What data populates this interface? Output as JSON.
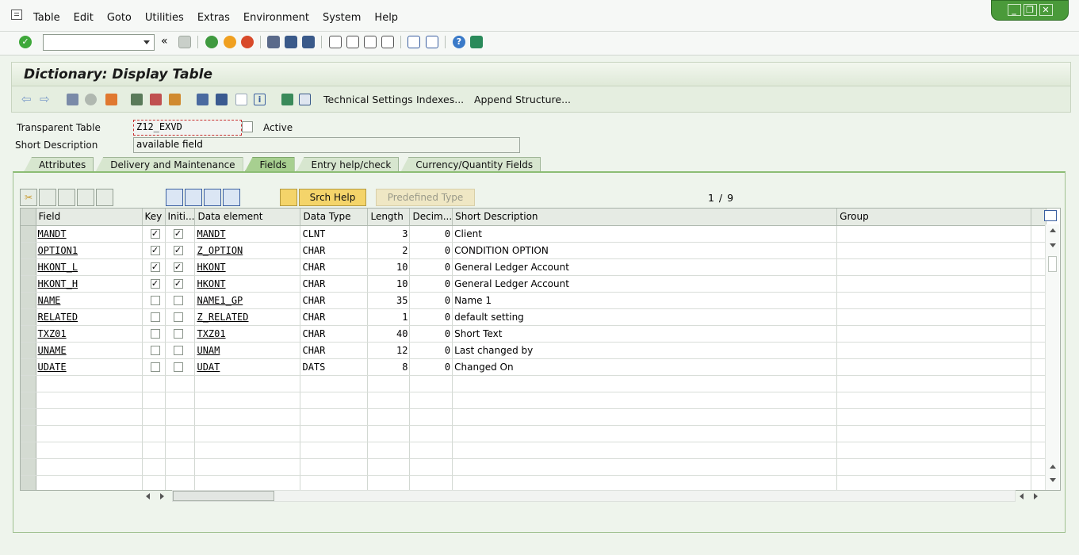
{
  "menu": [
    "Table",
    "Edit",
    "Goto",
    "Utilities",
    "Extras",
    "Environment",
    "System",
    "Help"
  ],
  "window_controls": {
    "minimize": "_",
    "restore": "❐",
    "close": "✕"
  },
  "title": "Dictionary: Display Table",
  "app_toolbar": {
    "tech_settings": "Technical Settings",
    "indexes": "Indexes...",
    "append": "Append Structure..."
  },
  "header": {
    "table_label": "Transparent Table",
    "table_value": "Z12_EXVD",
    "status": "Active",
    "desc_label": "Short Description",
    "desc_value": "available field"
  },
  "tabs": [
    "Attributes",
    "Delivery and Maintenance",
    "Fields",
    "Entry help/check",
    "Currency/Quantity Fields"
  ],
  "active_tab": "Fields",
  "grid_toolbar": {
    "search_help": "Srch Help",
    "predefined_type": "Predefined Type",
    "pager": "1 / 9"
  },
  "columns": [
    "Field",
    "Key",
    "Initi...",
    "Data element",
    "Data Type",
    "Length",
    "Decim...",
    "Short Description",
    "Group"
  ],
  "rows": [
    {
      "field": "MANDT",
      "key": true,
      "init": true,
      "element": "MANDT",
      "type": "CLNT",
      "length": "3",
      "decimals": "0",
      "desc": "Client",
      "group": ""
    },
    {
      "field": "OPTION1",
      "key": true,
      "init": true,
      "element": "Z_OPTION",
      "type": "CHAR",
      "length": "2",
      "decimals": "0",
      "desc": "CONDITION OPTION",
      "group": ""
    },
    {
      "field": "HKONT_L",
      "key": true,
      "init": true,
      "element": "HKONT",
      "type": "CHAR",
      "length": "10",
      "decimals": "0",
      "desc": "General Ledger Account",
      "group": ""
    },
    {
      "field": "HKONT_H",
      "key": true,
      "init": true,
      "element": "HKONT",
      "type": "CHAR",
      "length": "10",
      "decimals": "0",
      "desc": "General Ledger Account",
      "group": ""
    },
    {
      "field": "NAME",
      "key": false,
      "init": false,
      "element": "NAME1_GP",
      "type": "CHAR",
      "length": "35",
      "decimals": "0",
      "desc": "Name 1",
      "group": ""
    },
    {
      "field": "RELATED",
      "key": false,
      "init": false,
      "element": "Z_RELATED",
      "type": "CHAR",
      "length": "1",
      "decimals": "0",
      "desc": "default setting",
      "group": ""
    },
    {
      "field": "TXZ01",
      "key": false,
      "init": false,
      "element": "TXZ01",
      "type": "CHAR",
      "length": "40",
      "decimals": "0",
      "desc": "Short Text",
      "group": ""
    },
    {
      "field": "UNAME",
      "key": false,
      "init": false,
      "element": "UNAM",
      "type": "CHAR",
      "length": "12",
      "decimals": "0",
      "desc": "Last changed by",
      "group": ""
    },
    {
      "field": "UDATE",
      "key": false,
      "init": false,
      "element": "UDAT",
      "type": "DATS",
      "length": "8",
      "decimals": "0",
      "desc": "Changed On",
      "group": ""
    }
  ],
  "empty_rows": 7,
  "colors": {
    "accent_green": "#4a9a3a",
    "button_yellow": "#f4d46a",
    "tab_active": "#a7cf90"
  }
}
